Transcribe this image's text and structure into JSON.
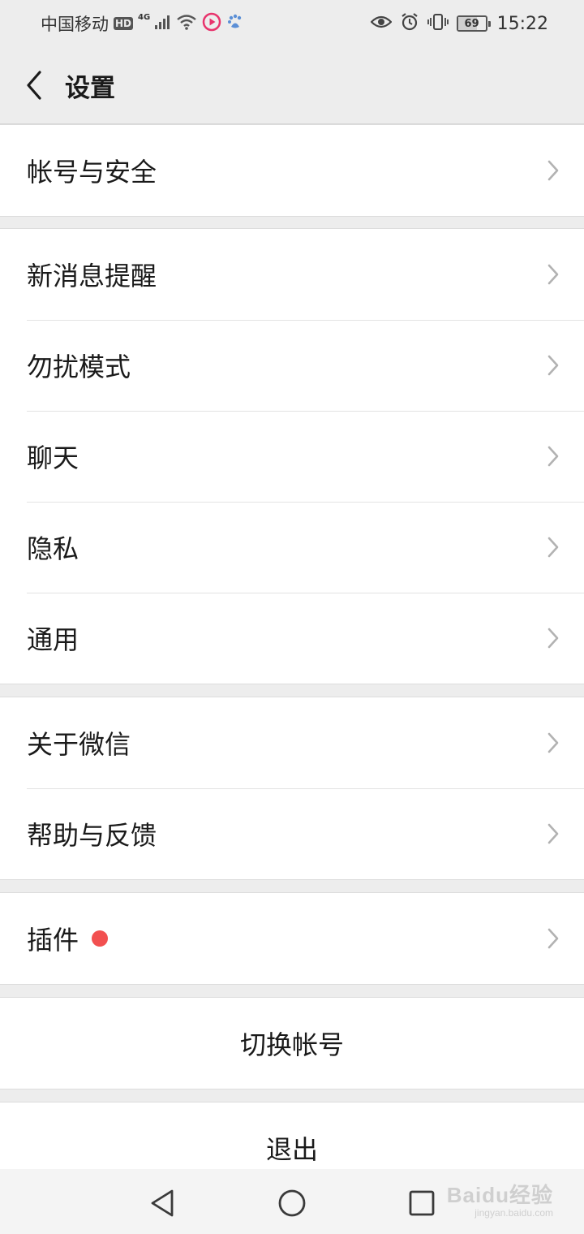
{
  "status_bar": {
    "carrier": "中国移动",
    "hd": "HD",
    "network": "4G",
    "battery_level": "69",
    "time": "15:22"
  },
  "header": {
    "title": "设置"
  },
  "groups": [
    {
      "items": [
        {
          "label": "帐号与安全"
        }
      ]
    },
    {
      "items": [
        {
          "label": "新消息提醒"
        },
        {
          "label": "勿扰模式"
        },
        {
          "label": "聊天"
        },
        {
          "label": "隐私"
        },
        {
          "label": "通用"
        }
      ]
    },
    {
      "items": [
        {
          "label": "关于微信"
        },
        {
          "label": "帮助与反馈"
        }
      ]
    },
    {
      "items": [
        {
          "label": "插件",
          "badge": "red-dot"
        }
      ]
    }
  ],
  "actions": {
    "switch_account": "切换帐号",
    "logout": "退出"
  },
  "watermark": {
    "main": "Baidu经验",
    "sub": "jingyan.baidu.com"
  },
  "colors": {
    "background": "#ededed",
    "cell": "#ffffff",
    "badge": "#f25050"
  }
}
